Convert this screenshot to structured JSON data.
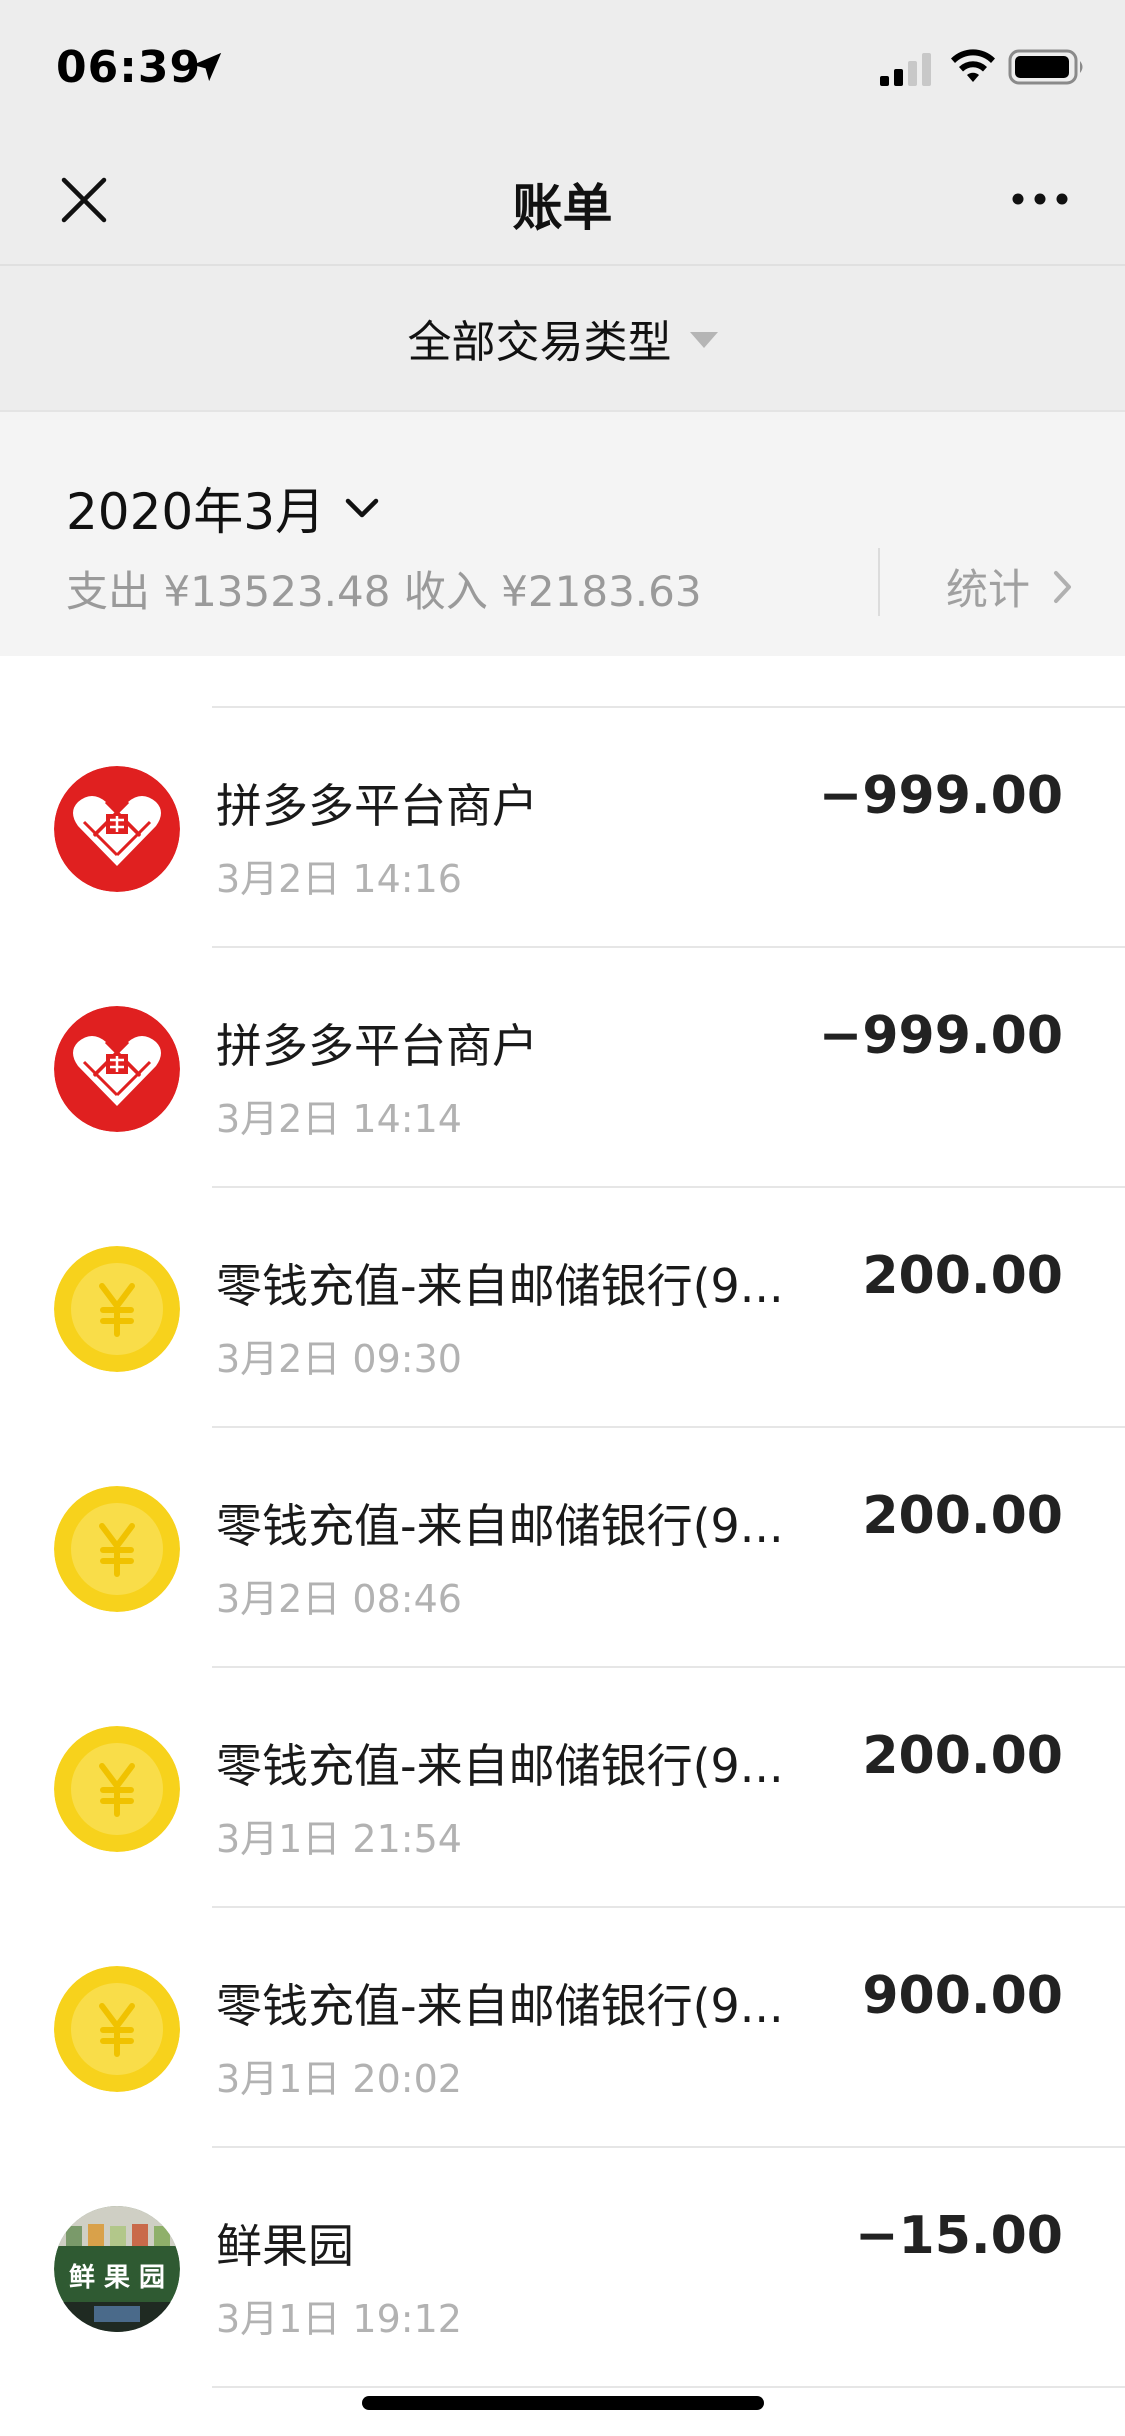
{
  "status_bar": {
    "time": "06:39",
    "icons": [
      "location-arrow-icon",
      "signal-icon",
      "wifi-icon",
      "battery-icon"
    ]
  },
  "nav": {
    "title": "账单",
    "left_icon": "close-icon",
    "right_icon": "more-icon"
  },
  "filter": {
    "label": "全部交易类型",
    "icon": "caret-down-icon"
  },
  "month": {
    "label": "2020年3月",
    "summary": "支出 ¥13523.48 收入 ¥2183.63",
    "stats_label": "统计"
  },
  "colors": {
    "header_bg": "#ededed",
    "summary_bg": "#f4f4f4",
    "pdd_red": "#e02020",
    "coin_yellow": "#f7d21c",
    "text_primary": "#1a1a1a",
    "text_secondary": "#b2b2b2"
  },
  "transactions": [
    {
      "title": "拼多多平台商户",
      "time": "3月2日 14:16",
      "amount": "−999.00",
      "icon": "pinduoduo-logo-icon"
    },
    {
      "title": "拼多多平台商户",
      "time": "3月2日 14:14",
      "amount": "−999.00",
      "icon": "pinduoduo-logo-icon"
    },
    {
      "title": "零钱充值-来自邮储银行(9...",
      "time": "3月2日 09:30",
      "amount": "200.00",
      "icon": "yuan-coin-icon"
    },
    {
      "title": "零钱充值-来自邮储银行(9...",
      "time": "3月2日 08:46",
      "amount": "200.00",
      "icon": "yuan-coin-icon"
    },
    {
      "title": "零钱充值-来自邮储银行(9...",
      "time": "3月1日 21:54",
      "amount": "200.00",
      "icon": "yuan-coin-icon"
    },
    {
      "title": "零钱充值-来自邮储银行(9...",
      "time": "3月1日 20:02",
      "amount": "900.00",
      "icon": "yuan-coin-icon"
    },
    {
      "title": "鲜果园",
      "time": "3月1日 19:12",
      "amount": "−15.00",
      "icon": "store-avatar-icon",
      "avatar_text": "鲜 果 园"
    }
  ]
}
